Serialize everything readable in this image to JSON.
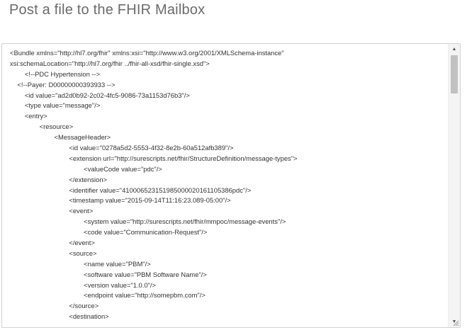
{
  "header": {
    "title": "Post a file to the FHIR Mailbox"
  },
  "icons": {
    "scroll_up": "triangle-up",
    "scroll_down": "triangle-down",
    "resize": "resize-grip"
  },
  "editor": {
    "lines": [
      "<Bundle xmlns=\"http://hl7.org/fhir\" xmlns:xsi=\"http://www.w3.org/2001/XMLSchema-instance\"",
      "xsi:schemaLocation=\"http://hl7.org/fhir ../fhir-all-xsd/fhir-single.xsd\">",
      "        <!--PDC Hypertension -->",
      "    <!--Payer: D00000000393933 -->",
      "        <id value=\"ad2d0b92-2c02-4fc5-9086-73a1153d76b3\"/>",
      "        <type value=\"message\"/>",
      "        <entry>",
      "                <resource>",
      "                        <MessageHeader>",
      "                                <id value=\"0278a5d2-5553-4f32-8e2b-60a512afb389\"/>",
      "                                <extension url=\"http://surescripts.net/fhir/StructureDefinition/message-types\">",
      "                                        <valueCode value=\"pdc\"/>",
      "                                </extension>",
      "                                <identifier value=\"410006523151985000020161105386pdc\"/>",
      "                                <timestamp value=\"2015-09-14T11:16:23.089-05:00\"/>",
      "                                <event>",
      "                                        <system value=\"http://surescripts.net/fhir/mmpoc/message-events\"/>",
      "                                        <code value=\"Communication-Request\"/>",
      "                                </event>",
      "                                <source>",
      "                                        <name value=\"PBM\"/>",
      "                                        <software value=\"PBM Software Name\"/>",
      "                                        <version value=\"1.0.0\"/>",
      "                                        <endpoint value=\"http://somepbm.com\"/>",
      "                                </source>",
      "                                <destination>"
    ]
  }
}
